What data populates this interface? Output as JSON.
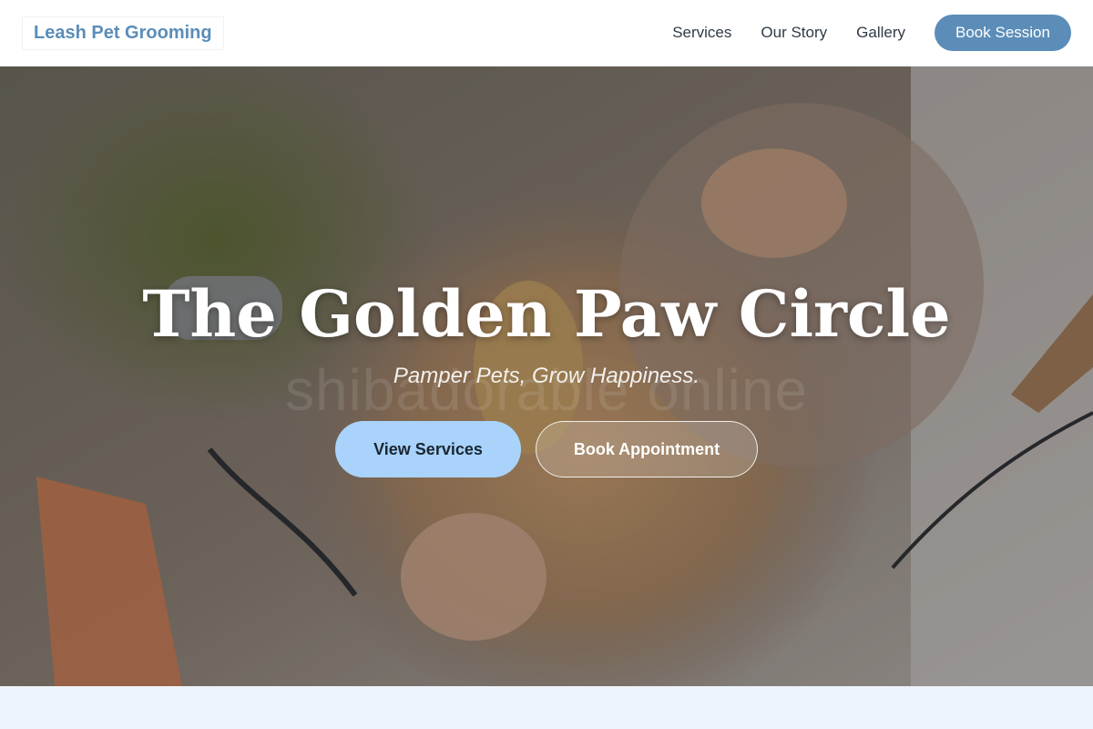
{
  "header": {
    "brand": "Leash Pet Grooming",
    "nav": [
      "Services",
      "Our Story",
      "Gallery"
    ],
    "cta": "Book Session"
  },
  "hero": {
    "title": "The Golden Paw Circle",
    "subtitle": "Pamper Pets, Grow Happiness.",
    "watermark": "shibadorable online",
    "primary_button": "View Services",
    "secondary_button": "Book Appointment"
  },
  "colors": {
    "brand": "#5b8db8",
    "primary_button_bg": "#a9d3fb",
    "page_bg": "#eef4fb"
  }
}
